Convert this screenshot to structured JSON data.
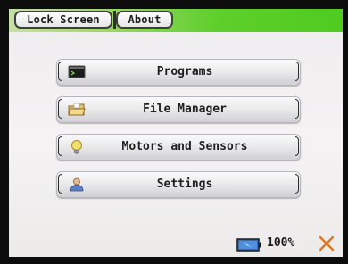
{
  "tabs": {
    "lock_screen": "Lock Screen",
    "about": "About"
  },
  "menu": {
    "items": [
      {
        "label": "Programs",
        "icon": "programs-terminal-icon"
      },
      {
        "label": "File Manager",
        "icon": "folder-icon"
      },
      {
        "label": "Motors and Sensors",
        "icon": "lightbulb-icon"
      },
      {
        "label": "Settings",
        "icon": "user-settings-icon"
      }
    ]
  },
  "status": {
    "battery_percent": "100%",
    "battery_level": 1.0,
    "close_icon": "close-icon"
  },
  "colors": {
    "accent_green": "#4fcb1f",
    "close_orange": "#e0781f"
  }
}
